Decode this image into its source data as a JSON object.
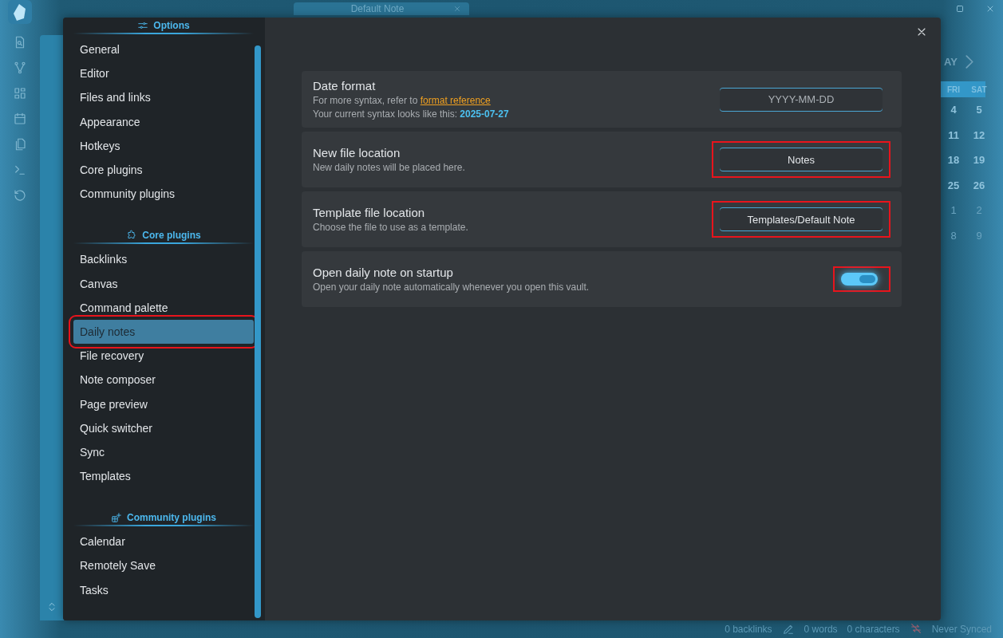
{
  "app": {
    "tab_title": "Default Note",
    "calendar": {
      "month_partial": "AY",
      "weekdays": [
        "FRI",
        "SAT"
      ],
      "weeks": [
        {
          "days": [
            "4",
            "5"
          ],
          "outside": false
        },
        {
          "days": [
            "11",
            "12"
          ],
          "outside": false
        },
        {
          "days": [
            "18",
            "19"
          ],
          "outside": false
        },
        {
          "days": [
            "25",
            "26"
          ],
          "outside": false
        },
        {
          "days": [
            "1",
            "2"
          ],
          "outside": true
        },
        {
          "days": [
            "8",
            "9"
          ],
          "outside": true
        }
      ]
    },
    "status_bar": {
      "backlinks": "0 backlinks",
      "words": "0 words",
      "characters": "0 characters",
      "sync": "Never Synced"
    }
  },
  "settings_modal": {
    "sidebar": [
      {
        "heading": "Options",
        "items": [
          {
            "label": "General",
            "selected": false,
            "highlighted": false
          },
          {
            "label": "Editor",
            "selected": false,
            "highlighted": false
          },
          {
            "label": "Files and links",
            "selected": false,
            "highlighted": false
          },
          {
            "label": "Appearance",
            "selected": false,
            "highlighted": false
          },
          {
            "label": "Hotkeys",
            "selected": false,
            "highlighted": false
          },
          {
            "label": "Core plugins",
            "selected": false,
            "highlighted": false
          },
          {
            "label": "Community plugins",
            "selected": false,
            "highlighted": false
          }
        ]
      },
      {
        "heading": "Core plugins",
        "items": [
          {
            "label": "Backlinks",
            "selected": false,
            "highlighted": false
          },
          {
            "label": "Canvas",
            "selected": false,
            "highlighted": false
          },
          {
            "label": "Command palette",
            "selected": false,
            "highlighted": false
          },
          {
            "label": "Daily notes",
            "selected": true,
            "highlighted": true
          },
          {
            "label": "File recovery",
            "selected": false,
            "highlighted": false
          },
          {
            "label": "Note composer",
            "selected": false,
            "highlighted": false
          },
          {
            "label": "Page preview",
            "selected": false,
            "highlighted": false
          },
          {
            "label": "Quick switcher",
            "selected": false,
            "highlighted": false
          },
          {
            "label": "Sync",
            "selected": false,
            "highlighted": false
          },
          {
            "label": "Templates",
            "selected": false,
            "highlighted": false
          }
        ]
      },
      {
        "heading": "Community plugins",
        "items": [
          {
            "label": "Calendar",
            "selected": false,
            "highlighted": false
          },
          {
            "label": "Remotely Save",
            "selected": false,
            "highlighted": false
          },
          {
            "label": "Tasks",
            "selected": false,
            "highlighted": false
          }
        ]
      }
    ],
    "settings": [
      {
        "name": "Date format",
        "description": [
          {
            "text": "For more syntax, refer to",
            "link": "format reference"
          },
          {
            "text": "Your current syntax looks like this:",
            "value": "2025-07-27"
          }
        ],
        "kind": "input",
        "placeholder": "YYYY-MM-DD",
        "highlighted": false
      },
      {
        "name": "New file location",
        "description": [
          {
            "text": "New daily notes will be placed here."
          }
        ],
        "kind": "input",
        "value": "Notes",
        "highlighted": true
      },
      {
        "name": "Template file location",
        "description": [
          {
            "text": "Choose the file to use as a template."
          }
        ],
        "kind": "input",
        "value": "Templates/Default Note",
        "highlighted": true
      },
      {
        "name": "Open daily note on startup",
        "description": [
          {
            "text": "Open your daily note automatically whenever you open this vault."
          }
        ],
        "kind": "toggle",
        "on": true,
        "highlighted": true
      }
    ]
  }
}
